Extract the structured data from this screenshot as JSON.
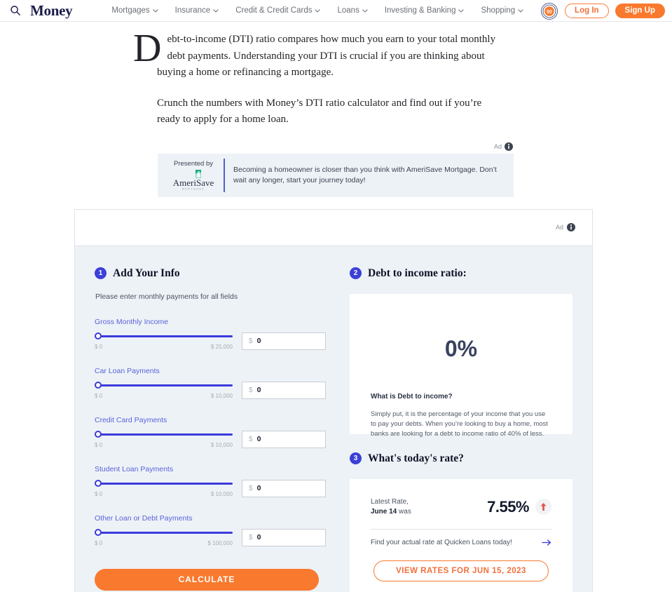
{
  "header": {
    "search_icon": "search-icon",
    "logo": "Money",
    "nav": [
      {
        "label": "Mortgages"
      },
      {
        "label": "Insurance"
      },
      {
        "label": "Credit & Credit Cards"
      },
      {
        "label": "Loans"
      },
      {
        "label": "Investing & Banking"
      },
      {
        "label": "Shopping"
      }
    ],
    "anniversary_badge": "50",
    "login_label": "Log In",
    "signup_label": "Sign Up"
  },
  "article": {
    "dropcap": "D",
    "paragraph1": "ebt-to-income (DTI) ratio compares how much you earn to your total monthly debt payments. Understanding your DTI is crucial if you are thinking about buying a home or refinancing a mortgage.",
    "paragraph2": "Crunch the numbers with Money’s DTI ratio calculator and find out if you’re ready to apply for a home loan."
  },
  "presented_ad": {
    "ad_label": "Ad",
    "presented_by": "Presented by",
    "advertiser": "AmeriSave",
    "advertiser_sub": "MORTGAGE",
    "copy": "Becoming a homeowner is closer than you think with AmeriSave Mortgage. Don’t wait any longer, start your journey today!"
  },
  "calculator": {
    "ad_label": "Ad",
    "step1": {
      "number": "1",
      "title": "Add Your Info",
      "subtitle": "Please enter monthly payments for all fields",
      "fields": [
        {
          "label": "Gross Monthly Income",
          "min": "$ 0",
          "max": "$ 25,000",
          "currency": "$",
          "value": "0"
        },
        {
          "label": "Car Loan Payments",
          "min": "$ 0",
          "max": "$ 10,000",
          "currency": "$",
          "value": "0"
        },
        {
          "label": "Credit Card Payments",
          "min": "$ 0",
          "max": "$ 10,000",
          "currency": "$",
          "value": "0"
        },
        {
          "label": "Student Loan Payments",
          "min": "$ 0",
          "max": "$ 10,000",
          "currency": "$",
          "value": "0"
        },
        {
          "label": "Other Loan or Debt Payments",
          "min": "$ 0",
          "max": "$ 100,000",
          "currency": "$",
          "value": "0"
        }
      ],
      "calculate_label": "CALCULATE"
    },
    "step2": {
      "number": "2",
      "title": "Debt to income ratio:",
      "ratio_value": "0%",
      "question": "What is Debt to income?",
      "description": "Simply put, it is the percentage of your income that you use to pay your debts. When you’re looking to buy a home, most banks are looking for a debt to income ratio of 40% of less."
    },
    "step3": {
      "number": "3",
      "title": "What's today's rate?",
      "latest_rate_label": "Latest Rate,",
      "rate_date": "June 14",
      "rate_date_suffix": "was",
      "rate_value": "7.55%",
      "trend_icon": "arrow-up-icon",
      "link_text": "Find your actual rate at Quicken Loans today!",
      "link_arrow": "arrow-right-icon",
      "view_rates_label": "VIEW RATES FOR JUN 15, 2023"
    }
  },
  "colors": {
    "brand_orange": "#f9792e",
    "slider_blue": "#3b3bdb",
    "step_badge": "#3b40d8",
    "label_blue": "#5b62d8",
    "panel_bg": "#edf2f7",
    "trend_red": "#e0584d"
  }
}
